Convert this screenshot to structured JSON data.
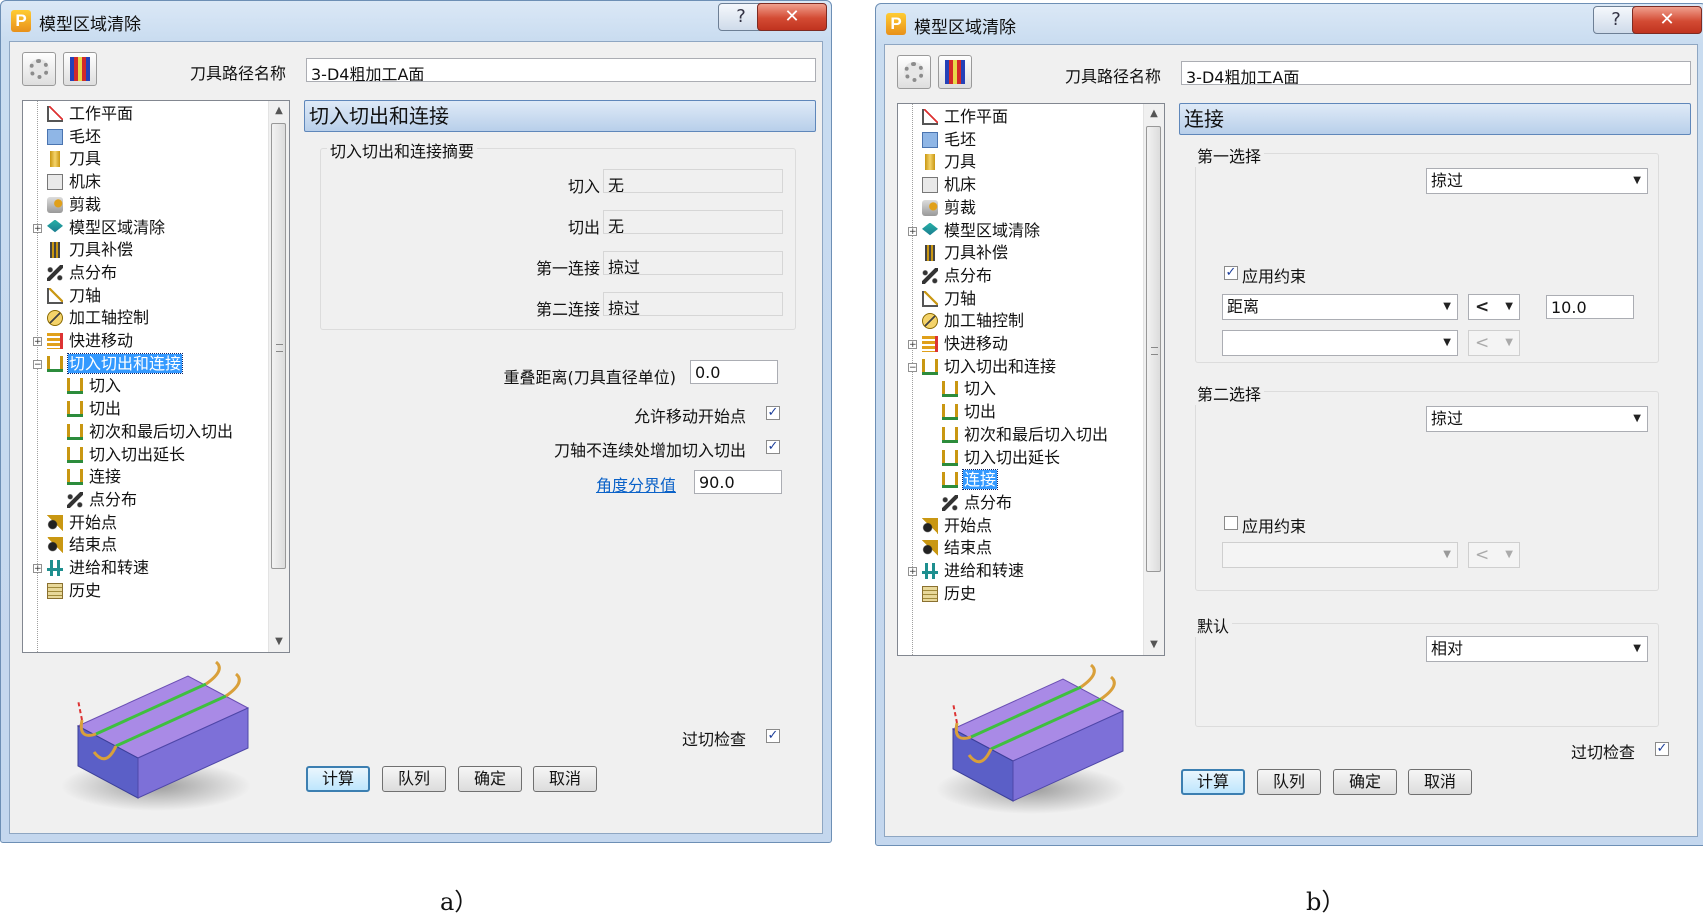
{
  "dialogs": [
    {
      "title": "模型区域清除",
      "toolpath_name_label": "刀具路径名称",
      "toolpath_name_value": "3-D4粗加工A面",
      "tree": [
        {
          "label": "工作平面",
          "icon": "workplane-icon",
          "level": 0
        },
        {
          "label": "毛坯",
          "icon": "block-icon",
          "level": 0
        },
        {
          "label": "刀具",
          "icon": "tool-icon",
          "level": 0
        },
        {
          "label": "机床",
          "icon": "machine-icon",
          "level": 0
        },
        {
          "label": "剪裁",
          "icon": "limit-icon",
          "level": 0
        },
        {
          "label": "模型区域清除",
          "icon": "area-clear-icon",
          "level": 0,
          "expander": "+"
        },
        {
          "label": "刀具补偿",
          "icon": "tool-compensation-icon",
          "level": 0
        },
        {
          "label": "点分布",
          "icon": "point-distribution-icon",
          "level": 0
        },
        {
          "label": "刀轴",
          "icon": "tool-axis-icon",
          "level": 0
        },
        {
          "label": "加工轴控制",
          "icon": "axis-control-icon",
          "level": 0
        },
        {
          "label": "快进移动",
          "icon": "rapid-move-icon",
          "level": 0,
          "expander": "+"
        },
        {
          "label": "切入切出和连接",
          "icon": "leads-links-icon",
          "level": 0,
          "expander": "−",
          "selected": true
        },
        {
          "label": "切入",
          "icon": "lead-in-icon",
          "level": 1
        },
        {
          "label": "切出",
          "icon": "lead-out-icon",
          "level": 1
        },
        {
          "label": "初次和最后切入切出",
          "icon": "first-last-lead-icon",
          "level": 1
        },
        {
          "label": "切入切出延长",
          "icon": "lead-extension-icon",
          "level": 1
        },
        {
          "label": "连接",
          "icon": "links-icon",
          "level": 1
        },
        {
          "label": "点分布",
          "icon": "point-distribution-icon",
          "level": 1
        },
        {
          "label": "开始点",
          "icon": "start-point-icon",
          "level": 0
        },
        {
          "label": "结束点",
          "icon": "end-point-icon",
          "level": 0
        },
        {
          "label": "进给和转速",
          "icon": "feeds-speeds-icon",
          "level": 0,
          "expander": "+"
        },
        {
          "label": "历史",
          "icon": "history-icon",
          "level": 0
        }
      ],
      "panel_title": "切入切出和连接",
      "summary": {
        "group_label": "切入切出和连接摘要",
        "rows": [
          {
            "label": "切入",
            "value": "无"
          },
          {
            "label": "切出",
            "value": "无"
          },
          {
            "label": "第一连接",
            "value": "掠过"
          },
          {
            "label": "第二连接",
            "value": "掠过"
          }
        ]
      },
      "overlap": {
        "label": "重叠距离(刀具直径单位)",
        "value": "0.0"
      },
      "allow_start_move": {
        "label": "允许移动开始点",
        "checked": true
      },
      "axis_discontinuity": {
        "label": "刀轴不连续处增加切入切出",
        "checked": true
      },
      "angle": {
        "label": "角度分界值",
        "value": "90.0"
      },
      "gouge_check": {
        "label": "过切检查",
        "checked": true
      },
      "buttons": [
        "计算",
        "队列",
        "确定",
        "取消"
      ]
    },
    {
      "title": "模型区域清除",
      "toolpath_name_label": "刀具路径名称",
      "toolpath_name_value": "3-D4粗加工A面",
      "tree": [
        {
          "label": "工作平面",
          "icon": "workplane-icon",
          "level": 0
        },
        {
          "label": "毛坯",
          "icon": "block-icon",
          "level": 0
        },
        {
          "label": "刀具",
          "icon": "tool-icon",
          "level": 0
        },
        {
          "label": "机床",
          "icon": "machine-icon",
          "level": 0
        },
        {
          "label": "剪裁",
          "icon": "limit-icon",
          "level": 0
        },
        {
          "label": "模型区域清除",
          "icon": "area-clear-icon",
          "level": 0,
          "expander": "+"
        },
        {
          "label": "刀具补偿",
          "icon": "tool-compensation-icon",
          "level": 0
        },
        {
          "label": "点分布",
          "icon": "point-distribution-icon",
          "level": 0
        },
        {
          "label": "刀轴",
          "icon": "tool-axis-icon",
          "level": 0
        },
        {
          "label": "加工轴控制",
          "icon": "axis-control-icon",
          "level": 0
        },
        {
          "label": "快进移动",
          "icon": "rapid-move-icon",
          "level": 0,
          "expander": "+"
        },
        {
          "label": "切入切出和连接",
          "icon": "leads-links-icon",
          "level": 0,
          "expander": "−"
        },
        {
          "label": "切入",
          "icon": "lead-in-icon",
          "level": 1
        },
        {
          "label": "切出",
          "icon": "lead-out-icon",
          "level": 1
        },
        {
          "label": "初次和最后切入切出",
          "icon": "first-last-lead-icon",
          "level": 1
        },
        {
          "label": "切入切出延长",
          "icon": "lead-extension-icon",
          "level": 1
        },
        {
          "label": "连接",
          "icon": "links-icon",
          "level": 1,
          "selected": true
        },
        {
          "label": "点分布",
          "icon": "point-distribution-icon",
          "level": 1
        },
        {
          "label": "开始点",
          "icon": "start-point-icon",
          "level": 0
        },
        {
          "label": "结束点",
          "icon": "end-point-icon",
          "level": 0
        },
        {
          "label": "进给和转速",
          "icon": "feeds-speeds-icon",
          "level": 0,
          "expander": "+"
        },
        {
          "label": "历史",
          "icon": "history-icon",
          "level": 0
        }
      ],
      "panel_title": "连接",
      "first_choice": {
        "group_label": "第一选择",
        "link_type": "掠过",
        "apply_constraint": {
          "label": "应用约束",
          "checked": true
        },
        "constraint1": {
          "type": "距离",
          "operator": "<",
          "value": "10.0"
        },
        "constraint2": {
          "type": "",
          "operator": "<"
        }
      },
      "second_choice": {
        "group_label": "第二选择",
        "link_type": "掠过",
        "apply_constraint": {
          "label": "应用约束",
          "checked": false
        },
        "constraint1": {
          "type": "",
          "operator": "<"
        }
      },
      "default": {
        "group_label": "默认",
        "link_type": "相对"
      },
      "gouge_check": {
        "label": "过切检查",
        "checked": true
      },
      "buttons": [
        "计算",
        "队列",
        "确定",
        "取消"
      ]
    }
  ],
  "captions": [
    "a）",
    "b）"
  ],
  "colors": {
    "selection": "#3399ff",
    "panel_header": "#b8cfea",
    "link": "#0b62c8",
    "preview_block": "#a98ae6"
  }
}
